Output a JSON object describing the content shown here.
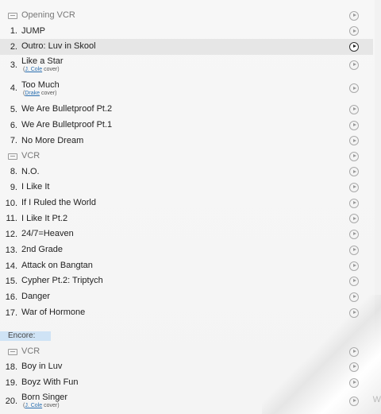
{
  "encore_label": "Encore:",
  "rows": [
    {
      "type": "vcr",
      "title": "Opening VCR"
    },
    {
      "num": "1.",
      "title": "JUMP"
    },
    {
      "num": "2.",
      "title": "Outro: Luv in Skool",
      "highlight": true
    },
    {
      "num": "3.",
      "title": "Like a Star",
      "cover_by": "J. Cole",
      "cover_word": "cover"
    },
    {
      "num": "4.",
      "title": "Too Much",
      "cover_by": "Drake",
      "cover_word": "cover"
    },
    {
      "num": "5.",
      "title": "We Are Bulletproof Pt.2"
    },
    {
      "num": "6.",
      "title": "We Are Bulletproof Pt.1"
    },
    {
      "num": "7.",
      "title": "No More Dream"
    },
    {
      "type": "vcr",
      "title": "VCR"
    },
    {
      "num": "8.",
      "title": "N.O."
    },
    {
      "num": "9.",
      "title": "I Like It"
    },
    {
      "num": "10.",
      "title": "If I Ruled the World"
    },
    {
      "num": "11.",
      "title": "I Like It Pt.2"
    },
    {
      "num": "12.",
      "title": "24/7=Heaven"
    },
    {
      "num": "13.",
      "title": "2nd Grade"
    },
    {
      "num": "14.",
      "title": "Attack on Bangtan"
    },
    {
      "num": "15.",
      "title": "Cypher Pt.2: Triptych"
    },
    {
      "num": "16.",
      "title": "Danger"
    },
    {
      "num": "17.",
      "title": "War of Hormone"
    },
    {
      "type": "vcr",
      "title": "VCR"
    },
    {
      "num": "18.",
      "title": "Boy in Luv"
    },
    {
      "num": "19.",
      "title": "Boyz With Fun"
    },
    {
      "num": "20.",
      "title": "Born Singer",
      "cover_by": "J. Cole",
      "cover_word": "cover"
    }
  ],
  "edge_glyph": "W"
}
